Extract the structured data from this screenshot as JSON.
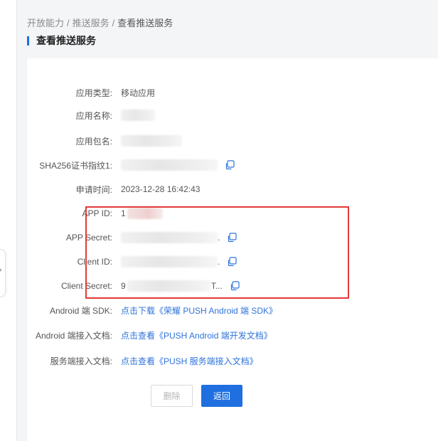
{
  "breadcrumb": {
    "items": [
      "开放能力",
      "推送服务",
      "查看推送服务"
    ],
    "separator": "/"
  },
  "page": {
    "title": "查看推送服务"
  },
  "details": {
    "app_type": {
      "label": "应用类型:",
      "value": "移动应用"
    },
    "app_name": {
      "label": "应用名称:"
    },
    "package_name": {
      "label": "应用包名:"
    },
    "sha256": {
      "label": "SHA256证书指纹1:"
    },
    "apply_time": {
      "label": "申请时间:",
      "value": "2023-12-28 16:42:43"
    },
    "app_id": {
      "label": "APP ID:",
      "value": "1"
    },
    "app_secret": {
      "label": "APP Secret:",
      "value": "."
    },
    "client_id": {
      "label": "Client ID:",
      "value": "."
    },
    "client_secret": {
      "label": "Client Secret:",
      "value": "9",
      "value_tail": "T..."
    },
    "android_sdk": {
      "label": "Android 端 SDK:",
      "link": "点击下载《荣耀 PUSH Android 端 SDK》"
    },
    "android_doc": {
      "label": "Android 端接入文档:",
      "link": "点击查看《PUSH Android 端开发文档》"
    },
    "server_doc": {
      "label": "服务端接入文档:",
      "link": "点击查看《PUSH 服务端接入文档》"
    }
  },
  "actions": {
    "delete_label": "删除",
    "back_label": "返回"
  },
  "icons": {
    "copy": "copy-icon",
    "expand": "chevron-right-icon"
  },
  "colors": {
    "accent": "#1f6fe0",
    "link": "#2f73da",
    "highlight_box": "#e43a3a"
  }
}
